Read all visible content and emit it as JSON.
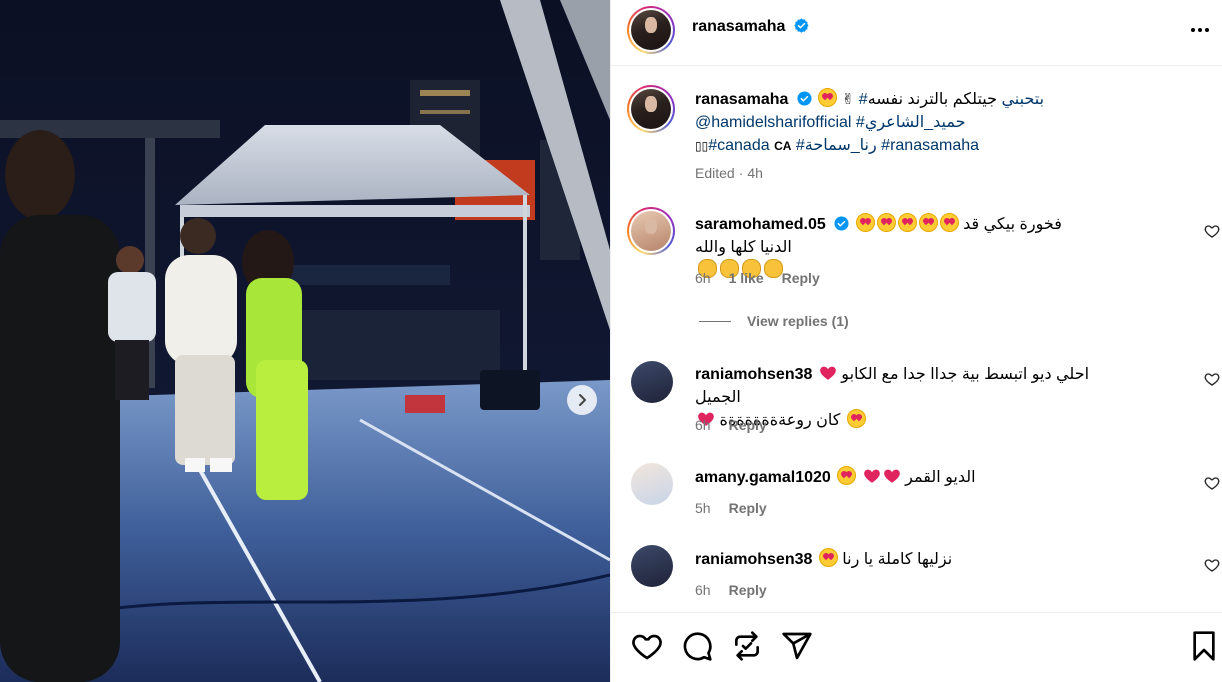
{
  "post": {
    "author": "ranasamaha",
    "caption": {
      "text": "جيتلكم بالترند نفسه ",
      "hashtag_1": "#بتحبني",
      "line2_mention": "@hamidelsharifofficial",
      "line2_hashtag": "#حميد_الشاعري",
      "line3_country_code": "CA",
      "line3_hashtag_a": "#رنا_سماحة",
      "line3_hashtag_b": "#ranasamaha",
      "line3_hashtag_c": "#canada",
      "edited_label": "Edited",
      "time": "4h"
    }
  },
  "comments": [
    {
      "username": "saramohamed.05",
      "verified": true,
      "text": "فخورة بيكي قد الدنيا كلها والله",
      "time": "6h",
      "likes": "1 like",
      "reply_label": "Reply"
    },
    {
      "username": "raniamohsen38",
      "verified": false,
      "text": "احلي ديو اتبسط بية جداا جدا مع الكابو الجميل",
      "text2": "كان روعةةةةةةةة",
      "time": "6h",
      "reply_label": "Reply"
    },
    {
      "username": "amany.gamal1020",
      "verified": false,
      "text": "الديو القمر",
      "time": "5h",
      "reply_label": "Reply"
    },
    {
      "username": "raniamohsen38",
      "verified": false,
      "text": "نزليها كاملة يا رنا",
      "time": "6h",
      "reply_label": "Reply"
    }
  ],
  "view_replies": "View replies (1)",
  "icons": {
    "more": "more-horizontal-icon",
    "like": "heart-icon",
    "comment": "comment-icon",
    "share": "repost-icon",
    "send": "send-icon",
    "save": "bookmark-icon",
    "next": "chevron-right-icon"
  },
  "colors": {
    "verified": "#0095f6",
    "hashtag": "#00376b",
    "meta_gray": "#737373",
    "heart_red": "#e0245e"
  }
}
